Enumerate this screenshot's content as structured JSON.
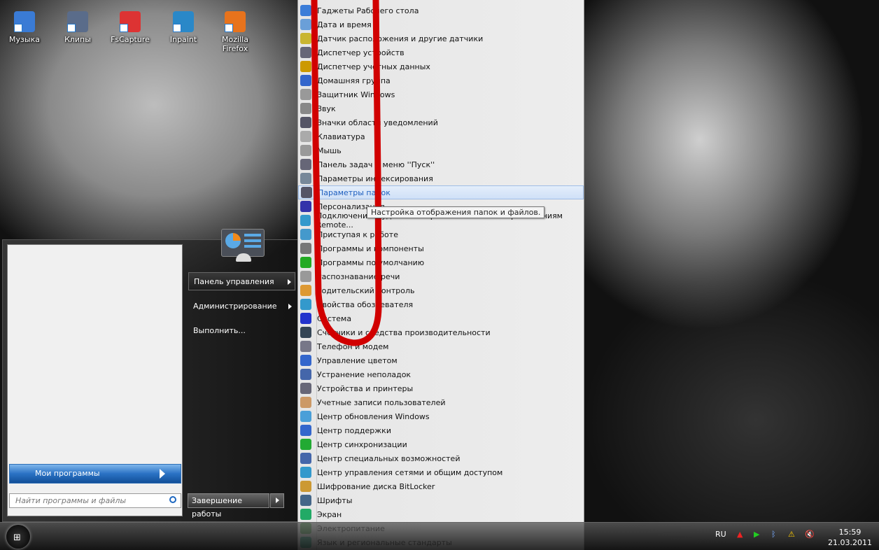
{
  "desktop": {
    "icons": [
      {
        "label": "Музыка",
        "color": "#3a7bd5"
      },
      {
        "label": "Клипы",
        "color": "#5a6c8a"
      },
      {
        "label": "FsCapture",
        "color": "#d33"
      },
      {
        "label": "Inpaint",
        "color": "#2a88c8"
      },
      {
        "label": "Mozilla Firefox",
        "color": "#e8731c"
      }
    ]
  },
  "control_panel_menu": {
    "items": [
      "Гаджеты Рабочего стола",
      "Дата и время",
      "Датчик расположения и другие датчики",
      "Диспетчер устройств",
      "Диспетчер учетных данных",
      "Домашняя группа",
      "Защитник Windows",
      "Звук",
      "Значки области уведомлений",
      "Клавиатура",
      "Мышь",
      "Панель задач и меню ''Пуск''",
      "Параметры индексирования",
      "Параметры папок",
      "Персонализация",
      "Подключения к удаленным рабочим столам и приложениям Remote...",
      "Приступая к работе",
      "Программы и компоненты",
      "Программы по умолчанию",
      "Распознавание речи",
      "Родительский контроль",
      "Свойства обозревателя",
      "Система",
      "Счетчики и средства производительности",
      "Телефон и модем",
      "Управление цветом",
      "Устранение неполадок",
      "Устройства и принтеры",
      "Учетные записи пользователей",
      "Центр обновления Windows",
      "Центр поддержки",
      "Центр синхронизации",
      "Центр специальных возможностей",
      "Центр управления сетями и общим доступом",
      "Шифрование диска BitLocker",
      "Шрифты",
      "Экран",
      "Электропитание",
      "Язык и региональные стандарты"
    ],
    "highlighted": "Параметры папок",
    "tooltip": "Настройка отображения папок и файлов.",
    "annotation_color": "#d10000"
  },
  "start_menu": {
    "all_programs": "Мои программы",
    "search_placeholder": "Найти программы и файлы",
    "right_items": [
      "Панель управления",
      "Администрирование",
      "Выполнить..."
    ],
    "shutdown": "Завершение работы"
  },
  "taskbar": {
    "language": "RU",
    "time": "15:59",
    "date": "21.03.2011"
  }
}
